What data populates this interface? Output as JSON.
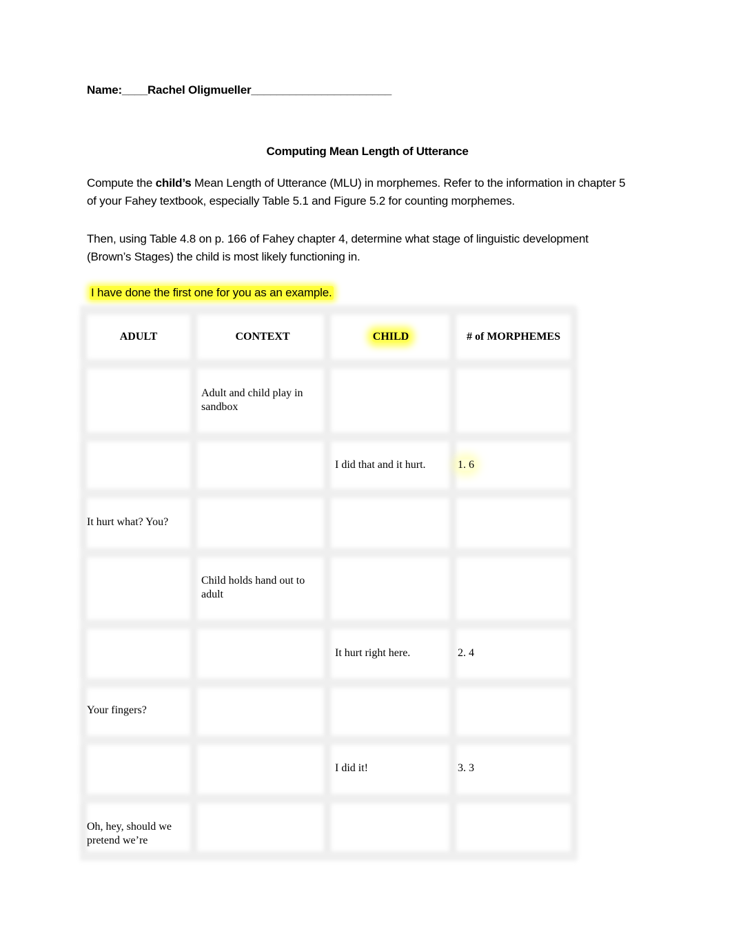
{
  "header": {
    "name_label": "Name:____",
    "name_value": "Rachel Oligmueller",
    "name_trailing": "______________________"
  },
  "title": "Computing Mean Length of Utterance",
  "instructions": {
    "p1_pre": "Compute the ",
    "p1_bold": "child’s",
    "p1_post": " Mean Length of Utterance (MLU) in morphemes. Refer to the information in chapter 5 of your Fahey textbook, especially Table 5.1 and Figure 5.2 for counting morphemes.",
    "p2": "Then, using Table 4.8 on p. 166 of Fahey chapter 4, determine what stage of linguistic development (Brown’s Stages) the child is most likely functioning in.",
    "example_note": "I have done the first one for you as an example."
  },
  "highlight_color": "#FFFF3A",
  "table": {
    "headers": [
      "ADULT",
      "CONTEXT",
      "CHILD",
      "# of MORPHEMES"
    ],
    "rows": [
      {
        "adult": "",
        "context": "Adult and child play in sandbox",
        "child": "",
        "morphemes": ""
      },
      {
        "adult": "",
        "context": "",
        "child": "I did that and it hurt.",
        "morphemes": "1. 6"
      },
      {
        "adult": "It hurt what? You?",
        "context": "",
        "child": "",
        "morphemes": ""
      },
      {
        "adult": "",
        "context": "Child holds hand out to adult",
        "child": "",
        "morphemes": ""
      },
      {
        "adult": "",
        "context": "",
        "child": "It hurt right here.",
        "morphemes": "2. 4"
      },
      {
        "adult": "Your fingers?",
        "context": "",
        "child": "",
        "morphemes": ""
      },
      {
        "adult": "",
        "context": "",
        "child": "I did it!",
        "morphemes": "3. 3"
      },
      {
        "adult": "Oh, hey, should we pretend we’re",
        "context": "",
        "child": "",
        "morphemes": ""
      }
    ]
  }
}
